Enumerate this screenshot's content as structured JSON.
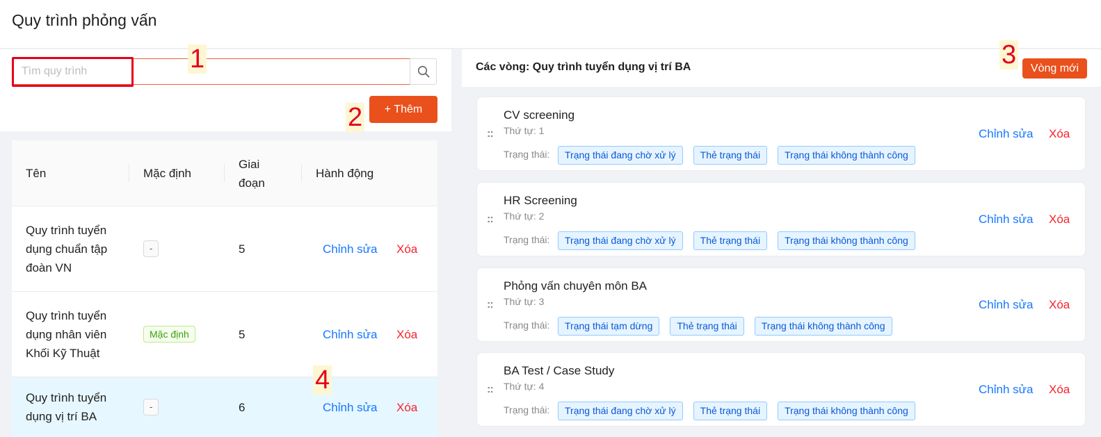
{
  "page": {
    "title": "Quy trình phỏng vấn"
  },
  "search": {
    "placeholder": "Tìm quy trình"
  },
  "toolbar": {
    "add_label": "+ Thêm"
  },
  "table": {
    "columns": [
      "Tên",
      "Mặc định",
      "Giai đoạn",
      "Hành động"
    ],
    "rows": [
      {
        "name": "Quy trình tuyển dụng chuẩn tập đoàn VN",
        "default": "-",
        "stages": "5",
        "edit": "Chỉnh sửa",
        "delete": "Xóa"
      },
      {
        "name": "Quy trình tuyển dụng nhân viên Khối Kỹ Thuật",
        "default": "Mặc định",
        "stages": "5",
        "edit": "Chỉnh sửa",
        "delete": "Xóa"
      },
      {
        "name": "Quy trình tuyển dụng vị trí BA",
        "default": "-",
        "stages": "6",
        "edit": "Chỉnh sửa",
        "delete": "Xóa"
      }
    ]
  },
  "rounds": {
    "title": "Các vòng: Quy trình tuyển dụng vị trí BA",
    "new_label": "Vòng mới",
    "status_label": "Trạng thái:",
    "edit_label": "Chỉnh sửa",
    "delete_label": "Xóa",
    "items": [
      {
        "name": "CV screening",
        "order": "Thứ tự: 1",
        "tags": [
          "Trạng thái đang chờ xử lý",
          "Thẻ trạng thái",
          "Trạng thái không thành công"
        ]
      },
      {
        "name": "HR Screening",
        "order": "Thứ tự: 2",
        "tags": [
          "Trạng thái đang chờ xử lý",
          "Thẻ trạng thái",
          "Trạng thái không thành công"
        ]
      },
      {
        "name": "Phỏng vấn chuyên môn BA",
        "order": "Thứ tự: 3",
        "tags": [
          "Trạng thái tạm dừng",
          "Thẻ trạng thái",
          "Trạng thái không thành công"
        ]
      },
      {
        "name": "BA Test / Case Study",
        "order": "Thứ tự: 4",
        "tags": [
          "Trạng thái đang chờ xử lý",
          "Thẻ trạng thái",
          "Trạng thái không thành công"
        ]
      }
    ]
  },
  "callouts": [
    "1",
    "2",
    "3",
    "4"
  ],
  "colors": {
    "accent": "#e9501c",
    "link": "#1677ff",
    "danger": "#f5222d",
    "callout": "#e4001b"
  }
}
